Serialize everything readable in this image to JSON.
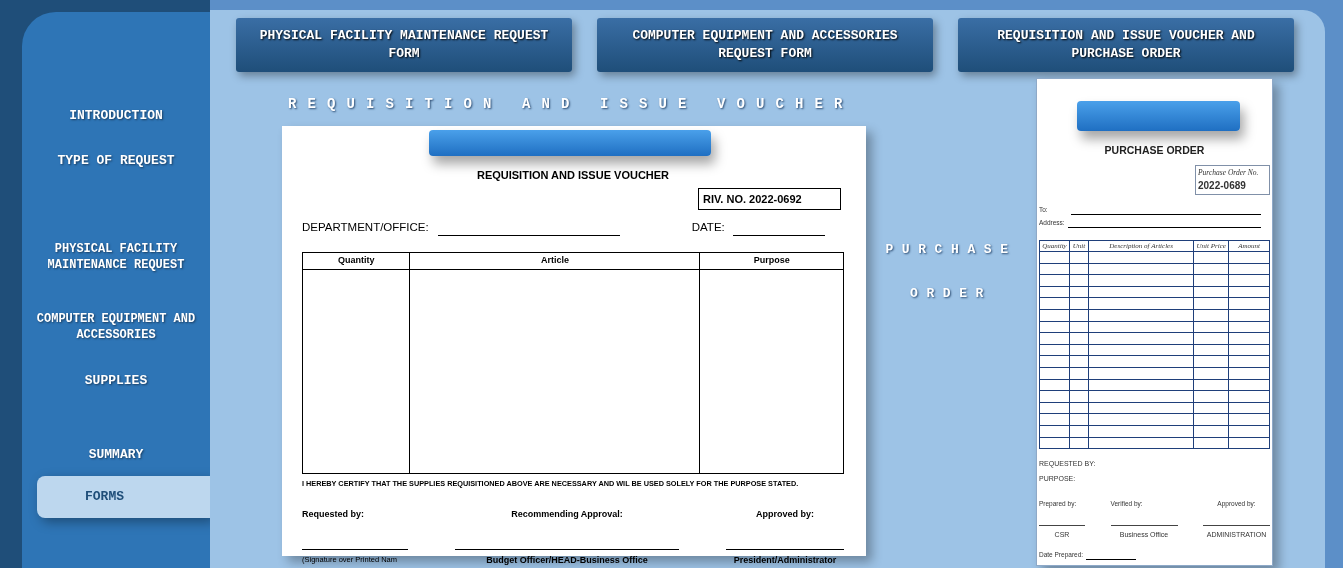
{
  "sidebar": {
    "items": [
      {
        "label": "INTRODUCTION",
        "selected": false
      },
      {
        "label": "TYPE OF REQUEST",
        "selected": false
      },
      {
        "label": "PHYSICAL FACILITY MAINTENANCE REQUEST",
        "selected": false
      },
      {
        "label": "COMPUTER EQUIPMENT AND ACCESSORIES",
        "selected": false
      },
      {
        "label": "SUPPLIES",
        "selected": false
      },
      {
        "label": "SUMMARY",
        "selected": false
      },
      {
        "label": "FORMS",
        "selected": true
      }
    ]
  },
  "top_buttons": [
    "PHYSICAL FACILITY MAINTENANCE REQUEST FORM",
    "COMPUTER EQUIPMENT AND ACCESSORIES REQUEST FORM",
    "REQUISITION AND ISSUE VOUCHER AND PURCHASE ORDER"
  ],
  "riv": {
    "heading": "REQUISITION AND ISSUE VOUCHER",
    "title": "REQUISITION AND ISSUE VOUCHER",
    "number": "RIV. NO. 2022-0692",
    "department_label": "DEPARTMENT/OFFICE:",
    "date_label": "DATE:",
    "columns": [
      "Quantity",
      "Article",
      "Purpose"
    ],
    "certification": "I HEREBY CERTIFY THAT THE SUPPLIES REQUISITIONED ABOVE ARE NECESSARY AND WIL BE USED SOLELY FOR THE PURPOSE STATED.",
    "signatories": [
      {
        "role": "Requested by:",
        "name": "(Signature over Printed Nam"
      },
      {
        "role": "Recommending Approval:",
        "name": "Budget Officer/HEAD-Business Office"
      },
      {
        "role": "Approved by:",
        "name": "President/Administrator"
      }
    ]
  },
  "po_label": [
    "PURCHASE",
    "ORDER"
  ],
  "po": {
    "title": "PURCHASE ORDER",
    "number_label": "Purchase Order No.",
    "number": "2022-0689",
    "to_label": "To:",
    "address_label": "Address:",
    "columns": [
      "Quantity",
      "Unit",
      "Description of Articles",
      "Unit Price",
      "Amount"
    ],
    "requested_by": "REQUESTED BY:",
    "purpose": "PURPOSE:",
    "signatories": [
      {
        "role": "Prepared by:",
        "name": "CSR"
      },
      {
        "role": "Verified by:",
        "name": "Business Office"
      },
      {
        "role": "Approved by:",
        "name": "ADMINISTRATION"
      }
    ],
    "date_prepared": "Date Prepared:"
  }
}
